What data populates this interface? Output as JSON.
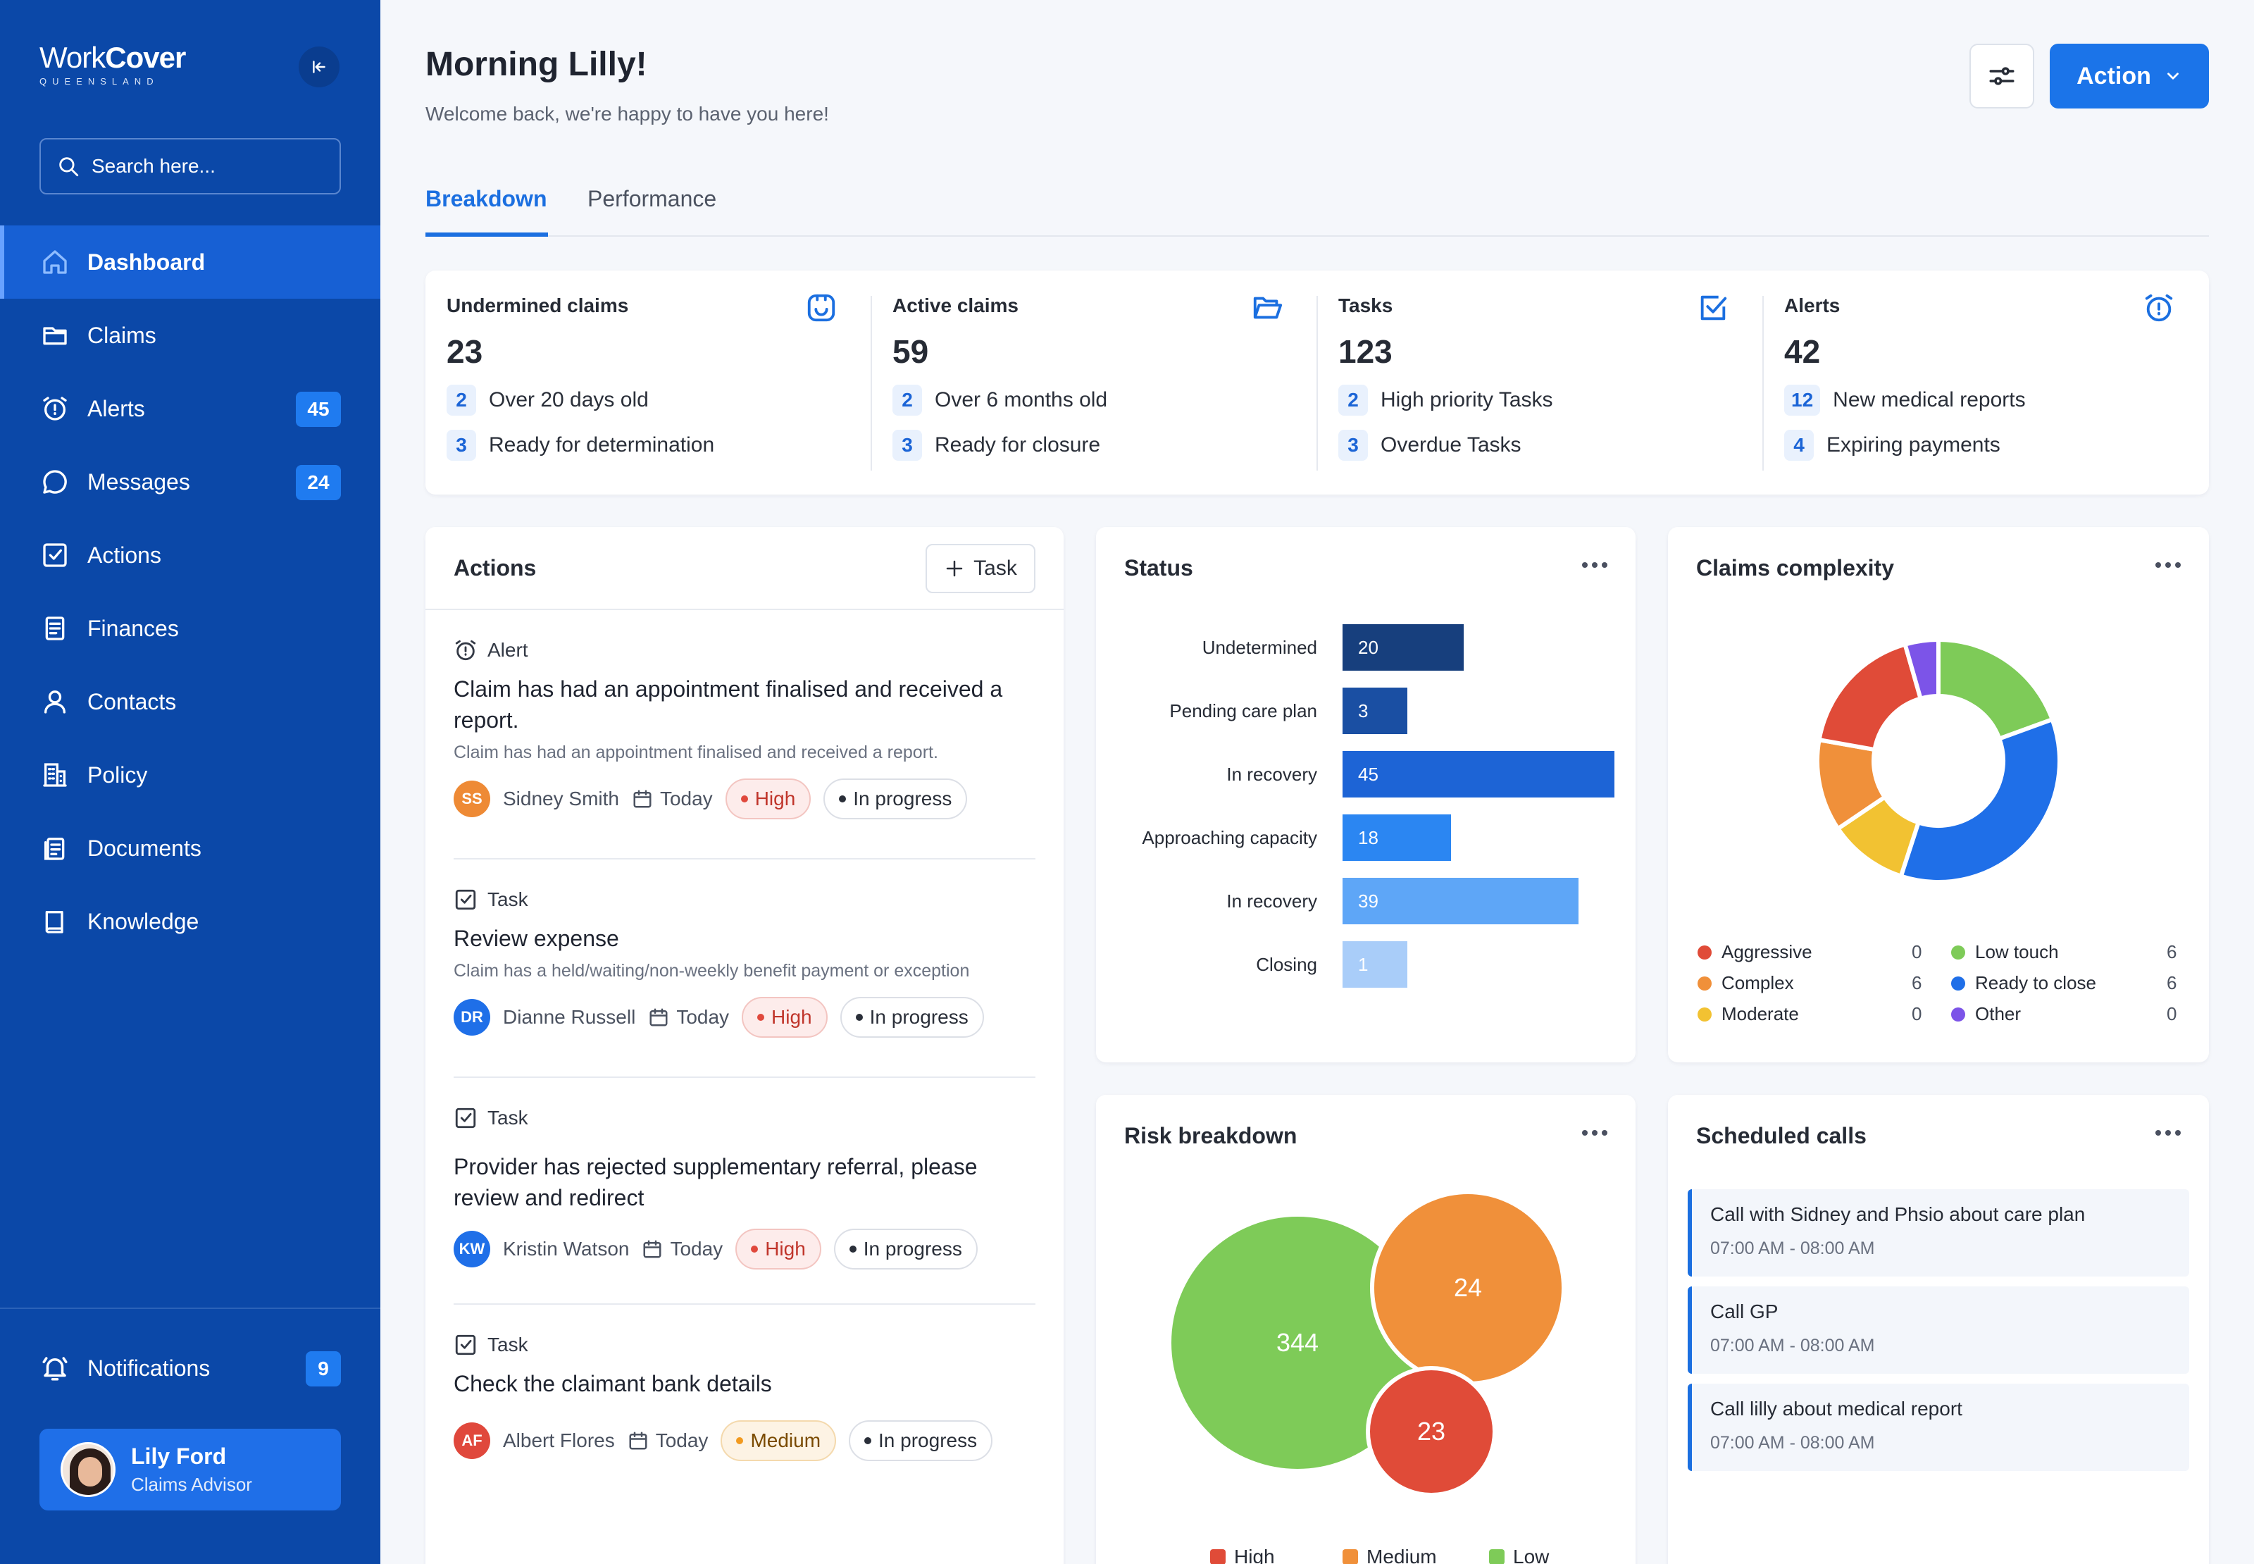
{
  "app": {
    "logo_word1": "Work",
    "logo_word2": "Cover",
    "logo_sub": "QUEENSLAND"
  },
  "sidebar": {
    "search_placeholder": "Search here...",
    "items": [
      {
        "label": "Dashboard",
        "icon": "home-icon",
        "active": true
      },
      {
        "label": "Claims",
        "icon": "folder-icon"
      },
      {
        "label": "Alerts",
        "icon": "alarm-icon",
        "badge": "45"
      },
      {
        "label": "Messages",
        "icon": "chat-icon",
        "badge": "24"
      },
      {
        "label": "Actions",
        "icon": "checkbox-icon"
      },
      {
        "label": "Finances",
        "icon": "receipt-icon"
      },
      {
        "label": "Contacts",
        "icon": "person-icon"
      },
      {
        "label": "Policy",
        "icon": "building-icon"
      },
      {
        "label": "Documents",
        "icon": "document-icon"
      },
      {
        "label": "Knowledge",
        "icon": "book-icon"
      }
    ],
    "notifications": {
      "label": "Notifications",
      "badge": "9"
    },
    "user": {
      "name": "Lily Ford",
      "role": "Claims Advisor"
    }
  },
  "header": {
    "greeting": "Morning Lilly!",
    "welcome": "Welcome back, we're happy to have you here!",
    "action_label": "Action"
  },
  "tabs": [
    {
      "label": "Breakdown",
      "active": true
    },
    {
      "label": "Performance"
    }
  ],
  "stats": [
    {
      "title": "Undermined claims",
      "value": "23",
      "icon": "face-box-icon",
      "lines": [
        {
          "n": "2",
          "text": "Over 20 days old"
        },
        {
          "n": "3",
          "text": "Ready for determination"
        }
      ]
    },
    {
      "title": "Active claims",
      "value": "59",
      "icon": "open-folder-icon",
      "lines": [
        {
          "n": "2",
          "text": "Over 6 months old"
        },
        {
          "n": "3",
          "text": "Ready for closure"
        }
      ]
    },
    {
      "title": "Tasks",
      "value": "123",
      "icon": "check-square-icon",
      "lines": [
        {
          "n": "2",
          "text": "High priority Tasks"
        },
        {
          "n": "3",
          "text": "Overdue Tasks"
        }
      ]
    },
    {
      "title": "Alerts",
      "value": "42",
      "icon": "alarm-clock-icon",
      "lines": [
        {
          "n": "12",
          "text": "New medical reports"
        },
        {
          "n": "4",
          "text": "Expiring payments"
        }
      ]
    }
  ],
  "actions": {
    "title": "Actions",
    "task_button": "Task",
    "items": [
      {
        "type": "Alert",
        "title": "Claim has had an appointment finalised and received a report.",
        "desc": "Claim has had an appointment finalised and received a report.",
        "initials": "SS",
        "avatar_color": "#ee8a35",
        "person": "Sidney Smith",
        "date": "Today",
        "priority": "High",
        "status": "In progress"
      },
      {
        "type": "Task",
        "title": "Review expense",
        "desc": "Claim has a held/waiting/non-weekly benefit payment or exception",
        "initials": "DR",
        "avatar_color": "#1f6fe8",
        "person": "Dianne Russell",
        "date": "Today",
        "priority": "High",
        "status": "In progress"
      },
      {
        "type": "Task",
        "title": "Provider has rejected supplementary referral, please review and redirect",
        "desc": "",
        "initials": "KW",
        "avatar_color": "#1f6fe8",
        "person": "Kristin Watson",
        "date": "Today",
        "priority": "High",
        "status": "In progress"
      },
      {
        "type": "Task",
        "title": "Check the claimant bank details",
        "desc": "",
        "initials": "AF",
        "avatar_color": "#e0483c",
        "person": "Albert Flores",
        "date": "Today",
        "priority": "Medium",
        "status": "In progress"
      }
    ]
  },
  "status": {
    "title": "Status",
    "chart_data": {
      "type": "bar",
      "orientation": "horizontal",
      "categories": [
        "Undetermined",
        "Pending care plan",
        "In recovery",
        "Approaching capacity",
        "In recovery",
        "Closing"
      ],
      "values": [
        20,
        3,
        45,
        18,
        39,
        1
      ],
      "colors": [
        "#173f7d",
        "#1a4fa3",
        "#1d64d6",
        "#2b86f2",
        "#5ea6f7",
        "#a9cdf9"
      ]
    }
  },
  "complexity": {
    "title": "Claims complexity",
    "chart_data": {
      "type": "pie",
      "style": "donut",
      "slices": [
        {
          "label": "Low touch",
          "value": 6,
          "color": "#7ecb58"
        },
        {
          "label": "Ready to close",
          "value": 6,
          "color": "#1f6fe8"
        },
        {
          "label": "Moderate",
          "value": 0,
          "color": "#f2c232"
        },
        {
          "label": "Complex",
          "value": 6,
          "color": "#f0903a"
        },
        {
          "label": "Aggressive",
          "value": 0,
          "color": "#e04b38"
        },
        {
          "label": "Other",
          "value": 0,
          "color": "#7c54e8"
        }
      ]
    },
    "legend": [
      {
        "label": "Aggressive",
        "value": "0",
        "color": "#e04b38"
      },
      {
        "label": "Complex",
        "value": "6",
        "color": "#f0903a"
      },
      {
        "label": "Moderate",
        "value": "0",
        "color": "#f2c232"
      },
      {
        "label": "Low touch",
        "value": "6",
        "color": "#7ecb58"
      },
      {
        "label": "Ready to close",
        "value": "6",
        "color": "#1f6fe8"
      },
      {
        "label": "Other",
        "value": "0",
        "color": "#7c54e8"
      }
    ]
  },
  "risk": {
    "title": "Risk breakdown",
    "chart_data": {
      "type": "bubble",
      "series": [
        {
          "name": "Low",
          "value": 344,
          "color": "#7ecb58"
        },
        {
          "name": "Medium",
          "value": 24,
          "color": "#f0903a"
        },
        {
          "name": "High",
          "value": 23,
          "color": "#e04b38"
        }
      ]
    },
    "legend": [
      {
        "label": "High",
        "color": "#e04b38"
      },
      {
        "label": "Medium",
        "color": "#f0903a"
      },
      {
        "label": "Low",
        "color": "#7ecb58"
      }
    ]
  },
  "calls": {
    "title": "Scheduled calls",
    "items": [
      {
        "title": "Call with Sidney and Phsio about care plan",
        "time": "07:00 AM - 08:00 AM"
      },
      {
        "title": "Call GP",
        "time": "07:00 AM - 08:00 AM"
      },
      {
        "title": "Call lilly about medical report",
        "time": "07:00 AM - 08:00 AM"
      }
    ]
  }
}
